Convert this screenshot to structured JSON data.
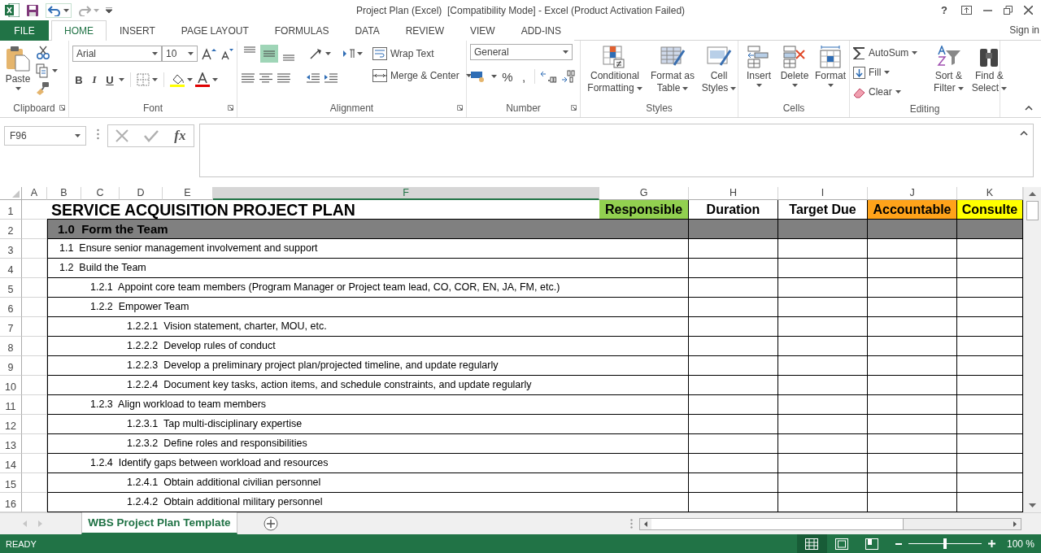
{
  "window": {
    "title": "Project Plan (Excel)  [Compatibility Mode] - Excel (Product Activation Failed)",
    "help": "?"
  },
  "tabs": [
    {
      "label": "FILE",
      "kind": "file",
      "selected": false
    },
    {
      "label": "HOME",
      "kind": "tab",
      "selected": true
    },
    {
      "label": "INSERT",
      "kind": "tab",
      "selected": false
    },
    {
      "label": "PAGE LAYOUT",
      "kind": "tab",
      "selected": false
    },
    {
      "label": "FORMULAS",
      "kind": "tab",
      "selected": false
    },
    {
      "label": "DATA",
      "kind": "tab",
      "selected": false
    },
    {
      "label": "REVIEW",
      "kind": "tab",
      "selected": false
    },
    {
      "label": "VIEW",
      "kind": "tab",
      "selected": false
    },
    {
      "label": "ADD-INS",
      "kind": "tab",
      "selected": false
    }
  ],
  "sign_in": "Sign in",
  "ribbon": {
    "clipboard": {
      "paste": "Paste",
      "label": "Clipboard"
    },
    "font": {
      "font_name": "Arial",
      "font_size": "10",
      "styles": [
        "B",
        "I",
        "U"
      ],
      "label": "Font"
    },
    "alignment": {
      "vertical_align": [
        {
          "selected": false
        },
        {
          "selected": true
        },
        {
          "selected": false
        }
      ],
      "wrap_text": "Wrap Text",
      "merge": "Merge & Center",
      "label": "Alignment"
    },
    "number": {
      "format": "General",
      "symbols": [
        "%",
        ","
      ],
      "label": "Number"
    },
    "styles": {
      "buttons": [
        "Conditional Formatting",
        "Format as Table",
        "Cell Styles"
      ],
      "label": "Styles"
    },
    "cells": {
      "buttons": [
        "Insert",
        "Delete",
        "Format"
      ],
      "label": "Cells"
    },
    "editing": {
      "commands": [
        "AutoSum",
        "Fill",
        "Clear"
      ],
      "buttons": [
        "Sort & Filter",
        "Find & Select"
      ],
      "label": "Editing"
    }
  },
  "formula_bar": {
    "name_box": "F96",
    "function_label": "fx"
  },
  "sheet": {
    "columns": [
      {
        "label": "A",
        "selected": false
      },
      {
        "label": "B",
        "selected": false
      },
      {
        "label": "C",
        "selected": false
      },
      {
        "label": "D",
        "selected": false
      },
      {
        "label": "E",
        "selected": false
      },
      {
        "label": "F",
        "selected": true
      },
      {
        "label": "G",
        "selected": false
      },
      {
        "label": "H",
        "selected": false
      },
      {
        "label": "I",
        "selected": false
      },
      {
        "label": "J",
        "selected": false
      },
      {
        "label": "K",
        "selected": false
      }
    ],
    "title_row": {
      "row": "1",
      "text": "SERVICE ACQUISITION PROJECT PLAN"
    },
    "role_headers": [
      {
        "label": "Responsible",
        "color": "#92d050"
      },
      {
        "label": "Duration",
        "color": "#ffffff"
      },
      {
        "label": "Target Due",
        "color": "#ffffff"
      },
      {
        "label": "Accountable",
        "color": "#ffa31a"
      },
      {
        "label": "Consulte",
        "color": "#ffff00"
      }
    ],
    "outline": [
      {
        "row": "2",
        "text": "1.0  Form the Team",
        "children": [
          {
            "row": "3",
            "text": "1.1  Ensure senior management involvement and support"
          },
          {
            "row": "4",
            "text": "1.2  Build the Team",
            "children": [
              {
                "row": "5",
                "text": "1.2.1  Appoint core team members (Program Manager or Project team lead, CO, COR, EN, JA, FM, etc.)"
              },
              {
                "row": "6",
                "text": "1.2.2  Empower Team",
                "children": [
                  {
                    "row": "7",
                    "text": "1.2.2.1  Vision statement, charter, MOU, etc."
                  },
                  {
                    "row": "8",
                    "text": "1.2.2.2  Develop rules of conduct"
                  },
                  {
                    "row": "9",
                    "text": "1.2.2.3  Develop a preliminary project plan/projected timeline, and update regularly"
                  },
                  {
                    "row": "10",
                    "text": "1.2.2.4  Document key tasks, action items, and schedule constraints, and update regularly"
                  }
                ]
              },
              {
                "row": "11",
                "text": "1.2.3  Align workload to team members",
                "children": [
                  {
                    "row": "12",
                    "text": "1.2.3.1  Tap multi-disciplinary expertise"
                  },
                  {
                    "row": "13",
                    "text": "1.2.3.2  Define roles and responsibilities"
                  }
                ]
              },
              {
                "row": "14",
                "text": "1.2.4  Identify gaps between workload and resources",
                "children": [
                  {
                    "row": "15",
                    "text": "1.2.4.1  Obtain additional civilian personnel"
                  },
                  {
                    "row": "16",
                    "text": "1.2.4.2  Obtain additional military personnel"
                  }
                ]
              }
            ]
          }
        ]
      }
    ]
  },
  "sheet_tabs": [
    {
      "label": "WBS Project Plan Template",
      "selected": true
    }
  ],
  "status_bar": {
    "status": "READY",
    "zoom_slider": {
      "level": 0.5
    },
    "zoom": "100 %"
  }
}
